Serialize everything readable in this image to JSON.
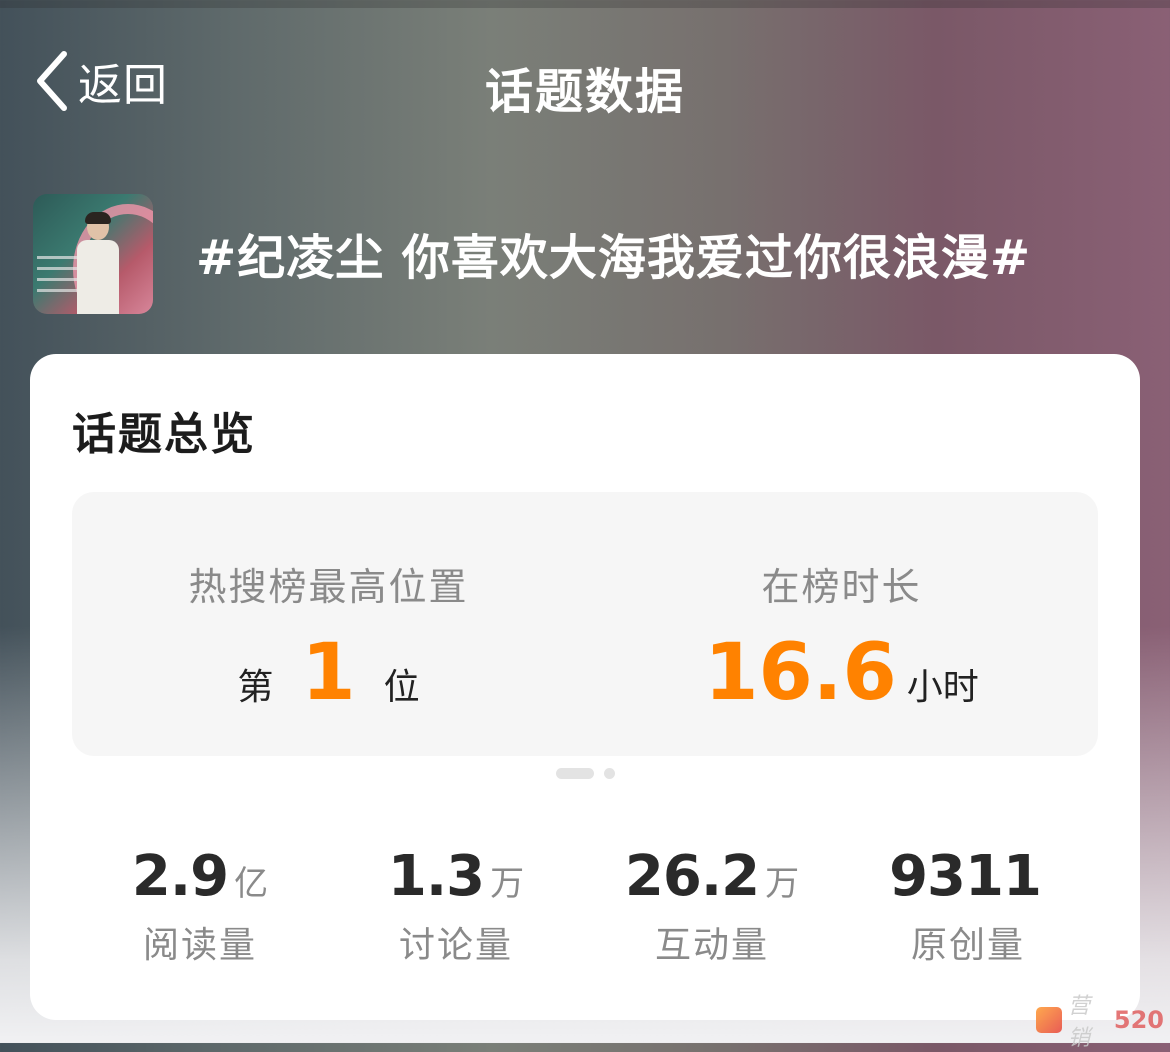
{
  "nav": {
    "back_label": "返回",
    "title": "话题数据"
  },
  "topic": {
    "title": "#纪凌尘 你喜欢大海我爱过你很浪漫#",
    "thumbnail_icon": "topic-cover-image"
  },
  "overview": {
    "title": "话题总览",
    "highlights": {
      "rank": {
        "label": "热搜榜最高位置",
        "prefix": "第",
        "value": "1",
        "suffix": "位"
      },
      "duration": {
        "label": "在榜时长",
        "value": "16.6",
        "unit": "小时"
      }
    },
    "pager": {
      "pages": 2,
      "active": 1
    },
    "stats": [
      {
        "value": "2.9",
        "unit": "亿",
        "label": "阅读量"
      },
      {
        "value": "1.3",
        "unit": "万",
        "label": "讨论量"
      },
      {
        "value": "26.2",
        "unit": "万",
        "label": "互动量"
      },
      {
        "value": "9311",
        "unit": "",
        "label": "原创量"
      }
    ]
  },
  "watermark": {
    "text": "营销",
    "number": "520"
  },
  "colors": {
    "accent": "#ff8200",
    "card_bg": "#ffffff",
    "highlight_bg": "#f6f6f6",
    "muted_text": "#8a8a8a"
  }
}
